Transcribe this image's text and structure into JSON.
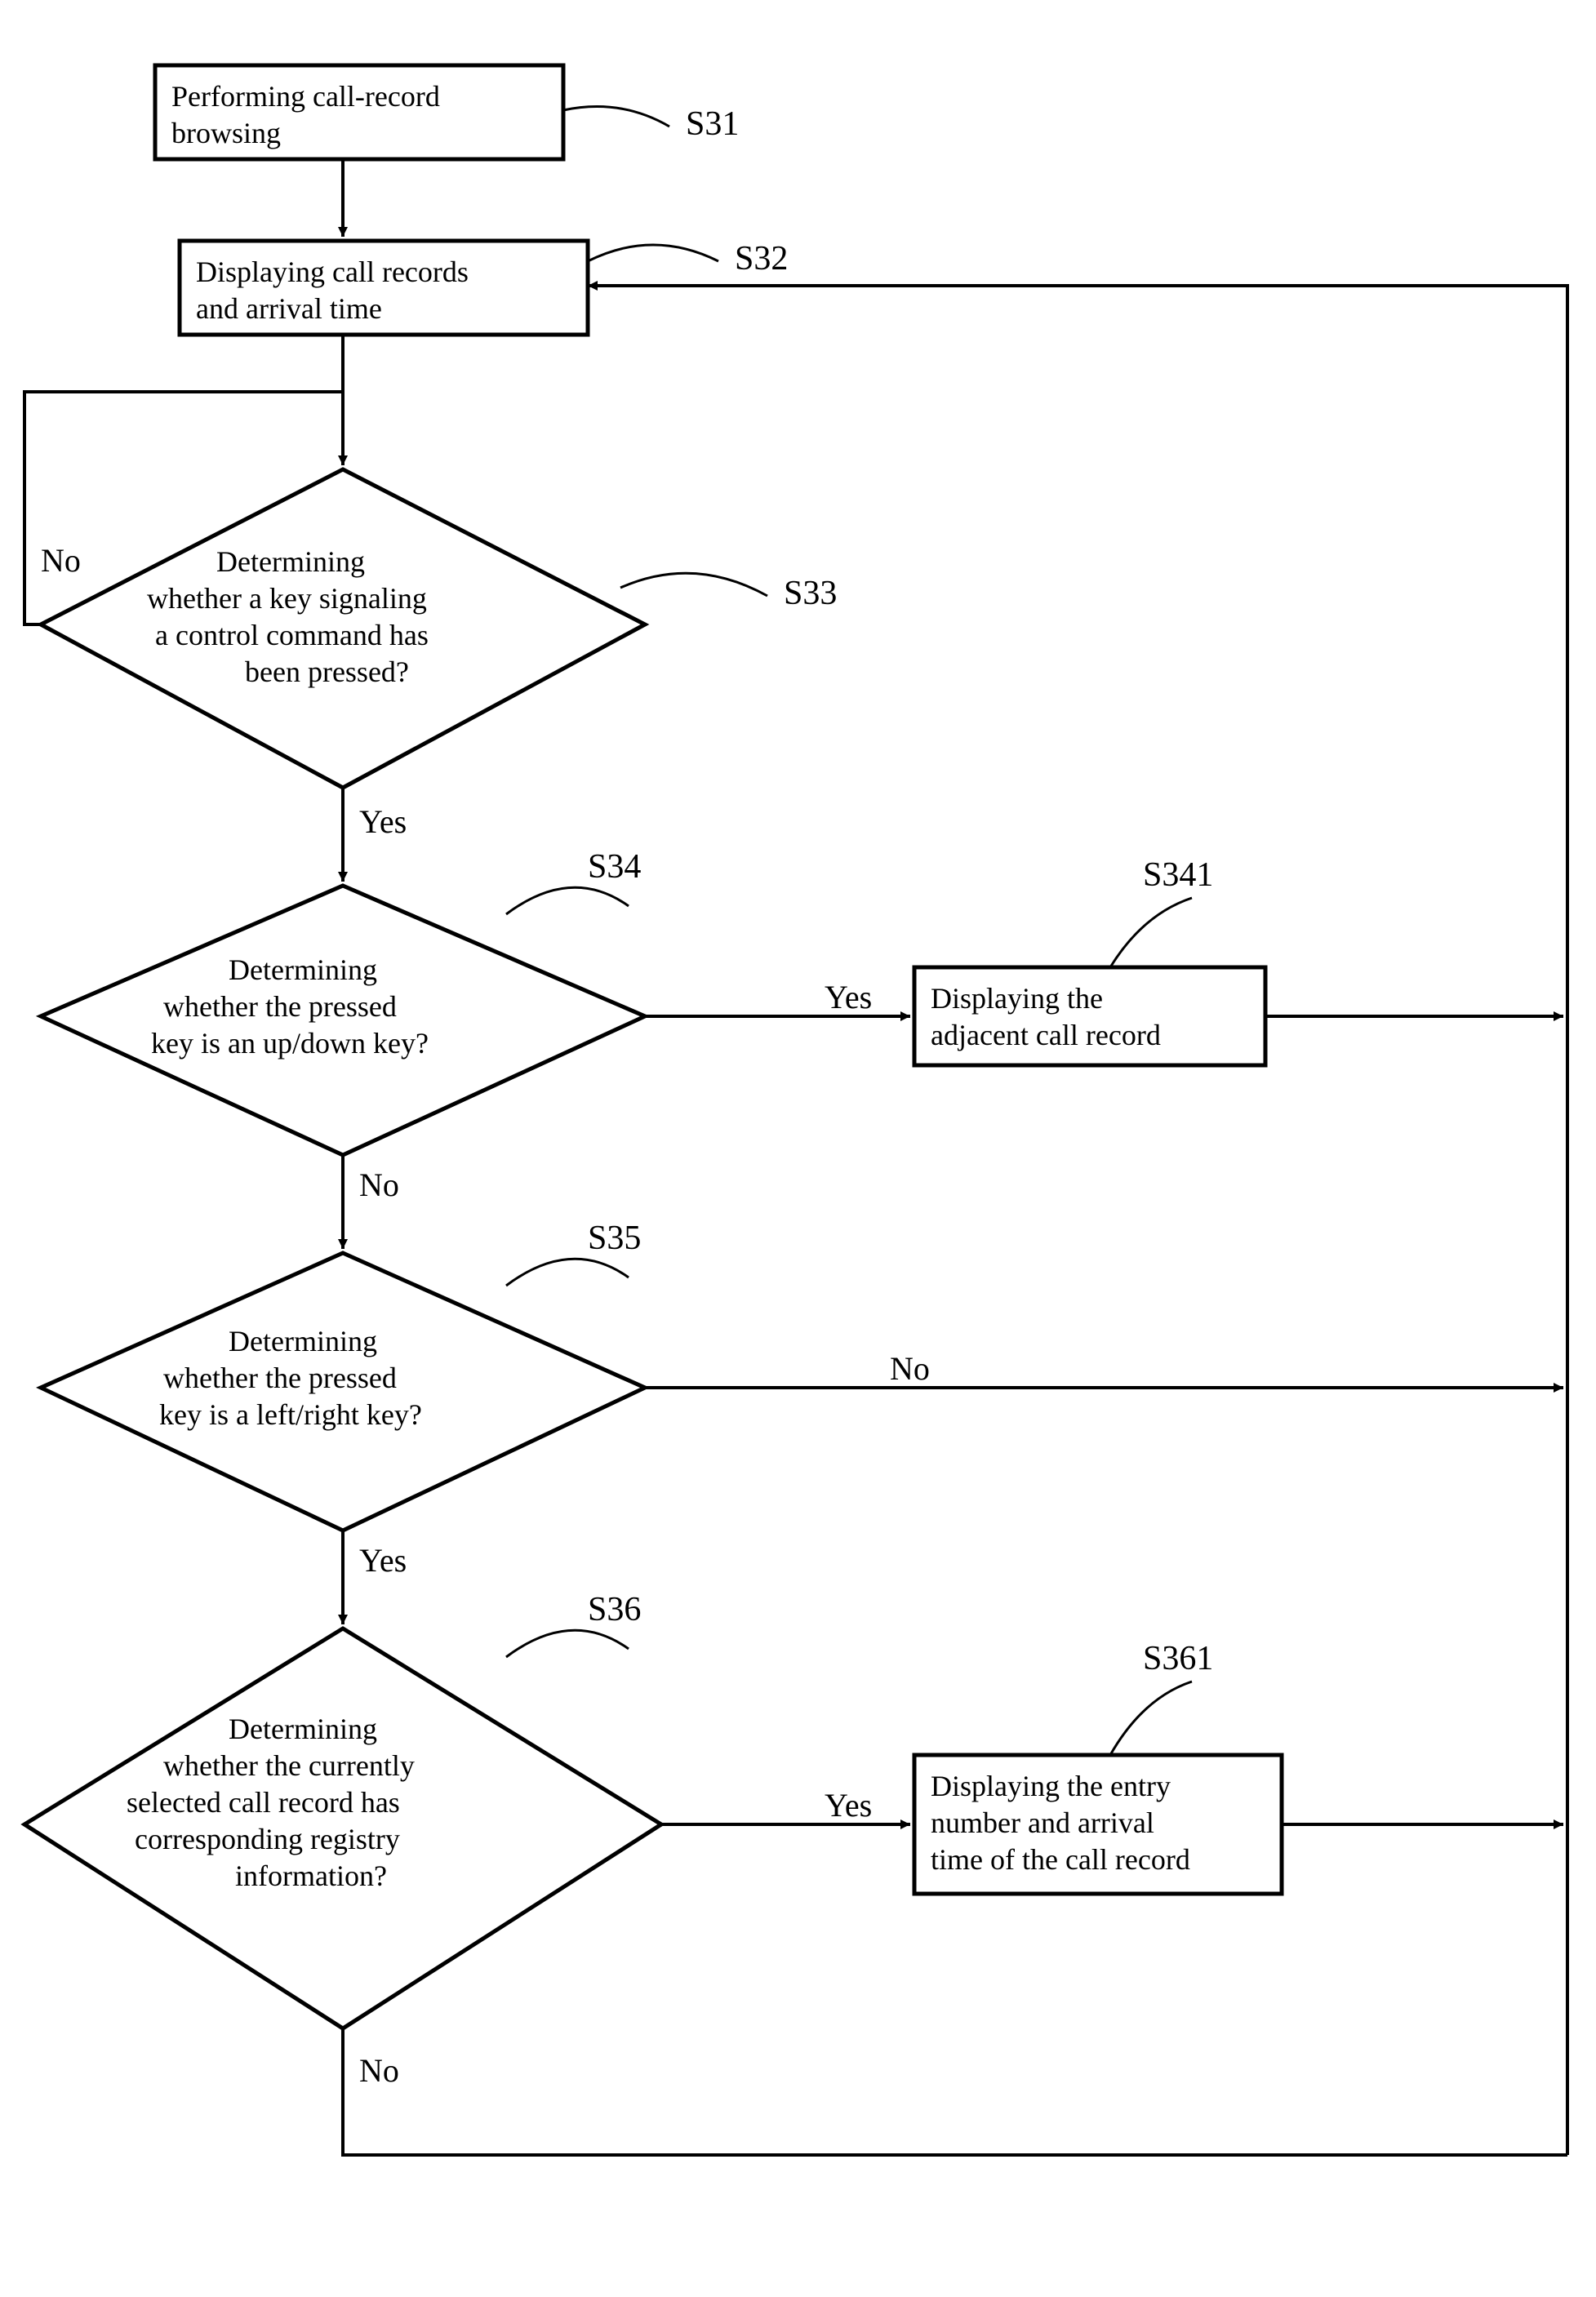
{
  "nodes": {
    "s31": {
      "id": "S31",
      "text": "Performing call-record browsing"
    },
    "s32": {
      "id": "S32",
      "text": "Displaying call records and arrival time"
    },
    "s33": {
      "id": "S33",
      "text": "Determining whether a key signaling a control command has been pressed?"
    },
    "s34": {
      "id": "S34",
      "text": "Determining whether the pressed key is an up/down key?"
    },
    "s341": {
      "id": "S341",
      "text": "Displaying the adjacent call record"
    },
    "s35": {
      "id": "S35",
      "text": "Determining whether the pressed key is a left/right key?"
    },
    "s36": {
      "id": "S36",
      "text": "Determining whether the currently selected call record has corresponding registry information?"
    },
    "s361": {
      "id": "S361",
      "text": "Displaying the entry number and arrival time of the call record"
    }
  },
  "labels": {
    "yes": "Yes",
    "no": "No"
  }
}
